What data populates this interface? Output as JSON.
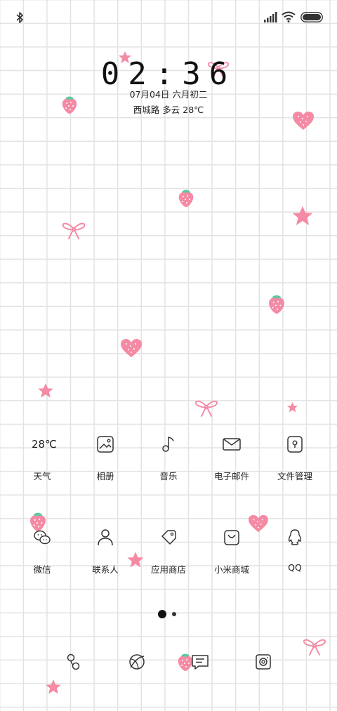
{
  "status_bar": {
    "left_icon": "bluetooth-icon",
    "right_icons": [
      "signal-icon",
      "wifi-icon",
      "battery-icon"
    ]
  },
  "lockclock": {
    "time": "02:36",
    "date": "07月04日 六月初二",
    "weather": "西城路 多云 28℃"
  },
  "apps_row1": [
    {
      "label": "天气",
      "icon_text": "28℃",
      "icon": "weather-icon"
    },
    {
      "label": "相册",
      "icon": "gallery-icon"
    },
    {
      "label": "音乐",
      "icon": "music-icon"
    },
    {
      "label": "电子邮件",
      "icon": "mail-icon"
    },
    {
      "label": "文件管理",
      "icon": "file-manager-icon"
    }
  ],
  "apps_row2": [
    {
      "label": "微信",
      "icon": "wechat-icon"
    },
    {
      "label": "联系人",
      "icon": "contacts-icon"
    },
    {
      "label": "应用商店",
      "icon": "app-store-icon"
    },
    {
      "label": "小米商城",
      "icon": "mi-store-icon"
    },
    {
      "label": "QQ",
      "icon": "qq-icon"
    }
  ],
  "page_indicator": {
    "pages": 2,
    "current": 1
  },
  "dock": [
    {
      "icon": "phone-icon"
    },
    {
      "icon": "browser-icon"
    },
    {
      "icon": "messages-icon"
    },
    {
      "icon": "camera-icon"
    }
  ],
  "colors": {
    "decor_pink": "#f48aa4",
    "leaf_green": "#5ec9a0",
    "grid": "#e3e3e3"
  }
}
